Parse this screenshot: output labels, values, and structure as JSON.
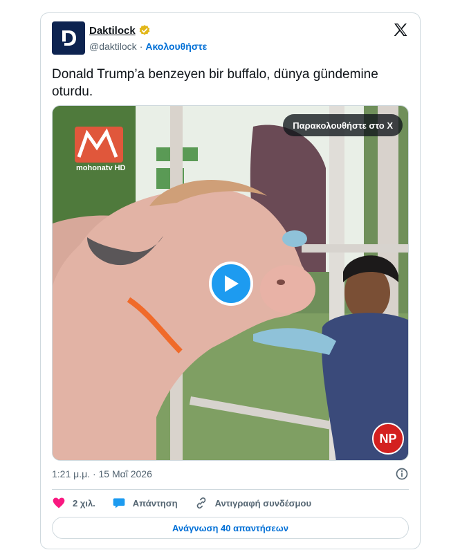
{
  "account": {
    "name": "Daktilock",
    "handle": "@daktilock",
    "separator": "·",
    "follow_label": "Ακολουθήστε",
    "avatar_letter": "D"
  },
  "tweet": {
    "text": "Donald Trump’a benzeyen bir buffalo, dünya gündemine oturdu."
  },
  "media": {
    "watch_label": "Παρακολουθήστε στο X",
    "watermark_left": "mohonatv HD",
    "watermark_right": "NP"
  },
  "meta": {
    "timestamp": "1:21 μ.μ. · 15 Μαΐ 2026"
  },
  "actions": {
    "likes": "2 χιλ.",
    "reply": "Απάντηση",
    "copy_link": "Αντιγραφή συνδέσμου"
  },
  "footer": {
    "read_replies": "Ανάγνωση 40 απαντήσεων"
  },
  "colors": {
    "accent": "#1d9bf0",
    "link": "#006fd6",
    "like": "#f91880",
    "verified": "#e2b719",
    "avatar_bg": "#0d2350"
  },
  "icons": [
    "x-logo-icon",
    "verified-badge-icon",
    "play-icon",
    "info-icon",
    "heart-icon",
    "reply-icon",
    "link-icon"
  ]
}
